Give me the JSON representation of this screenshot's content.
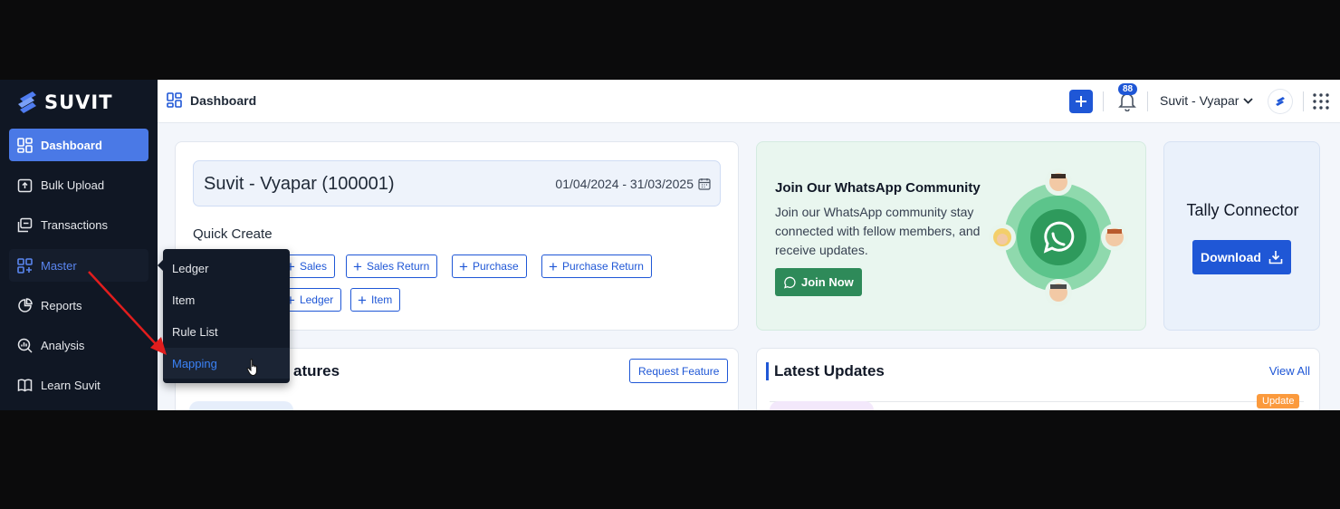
{
  "app": {
    "name": "SUVIT"
  },
  "sidebar": {
    "items": [
      {
        "label": "Dashboard",
        "icon": "dashboard-icon"
      },
      {
        "label": "Bulk Upload",
        "icon": "upload-icon"
      },
      {
        "label": "Transactions",
        "icon": "transactions-icon"
      },
      {
        "label": "Master",
        "icon": "master-icon"
      },
      {
        "label": "Reports",
        "icon": "pie-chart-icon"
      },
      {
        "label": "Analysis",
        "icon": "analysis-icon"
      },
      {
        "label": "Learn Suvit",
        "icon": "book-icon"
      }
    ]
  },
  "master_menu": {
    "items": [
      "Ledger",
      "Item",
      "Rule List",
      "Mapping"
    ],
    "active": "Mapping"
  },
  "topbar": {
    "title": "Dashboard",
    "notification_count": "88",
    "company_selector": "Suvit - Vyapar"
  },
  "company_card": {
    "name": "Suvit - Vyapar (100001)",
    "date_range": "01/04/2024 - 31/03/2025"
  },
  "quick_create": {
    "title": "Quick Create",
    "row1": [
      "Sales",
      "Sales Return",
      "Purchase",
      "Purchase Return"
    ],
    "row2": [
      "Ledger",
      "Item"
    ]
  },
  "whatsapp": {
    "title": "Join Our WhatsApp Community",
    "description": "Join our WhatsApp community stay connected with fellow members, and receive updates.",
    "button": "Join Now"
  },
  "tally": {
    "title": "Tally Connector",
    "button": "Download"
  },
  "features": {
    "title": "atures",
    "button": "Request Feature"
  },
  "updates": {
    "title": "Latest Updates",
    "view_all": "View All",
    "badge": "Update"
  },
  "colors": {
    "sidebar_bg": "#101724",
    "primary": "#1f57d6",
    "active_nav": "#4a79e6",
    "whatsapp_green": "#2e8a59",
    "annotation_red": "#e11d1d"
  }
}
